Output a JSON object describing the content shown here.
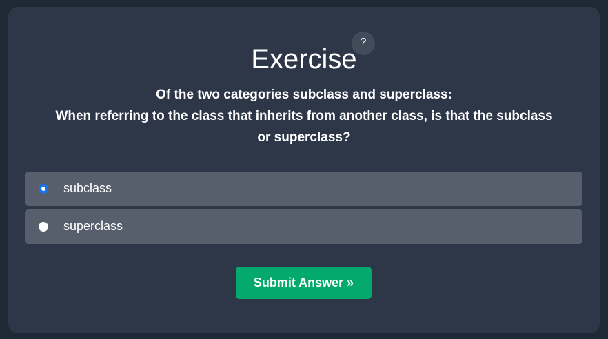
{
  "title": "Exercise",
  "help_label": "?",
  "question": {
    "line1": "Of the two categories subclass and superclass:",
    "line2": "When referring to the class that inherits from another class, is that the subclass or superclass?"
  },
  "options": [
    {
      "label": "subclass",
      "selected": true
    },
    {
      "label": "superclass",
      "selected": false
    }
  ],
  "submit_label": "Submit Answer »",
  "colors": {
    "background": "#1d2a35",
    "card": "#2d3748",
    "option": "#575f6c",
    "accent": "#04aa6d",
    "radio_selected": "#1a73e8"
  }
}
